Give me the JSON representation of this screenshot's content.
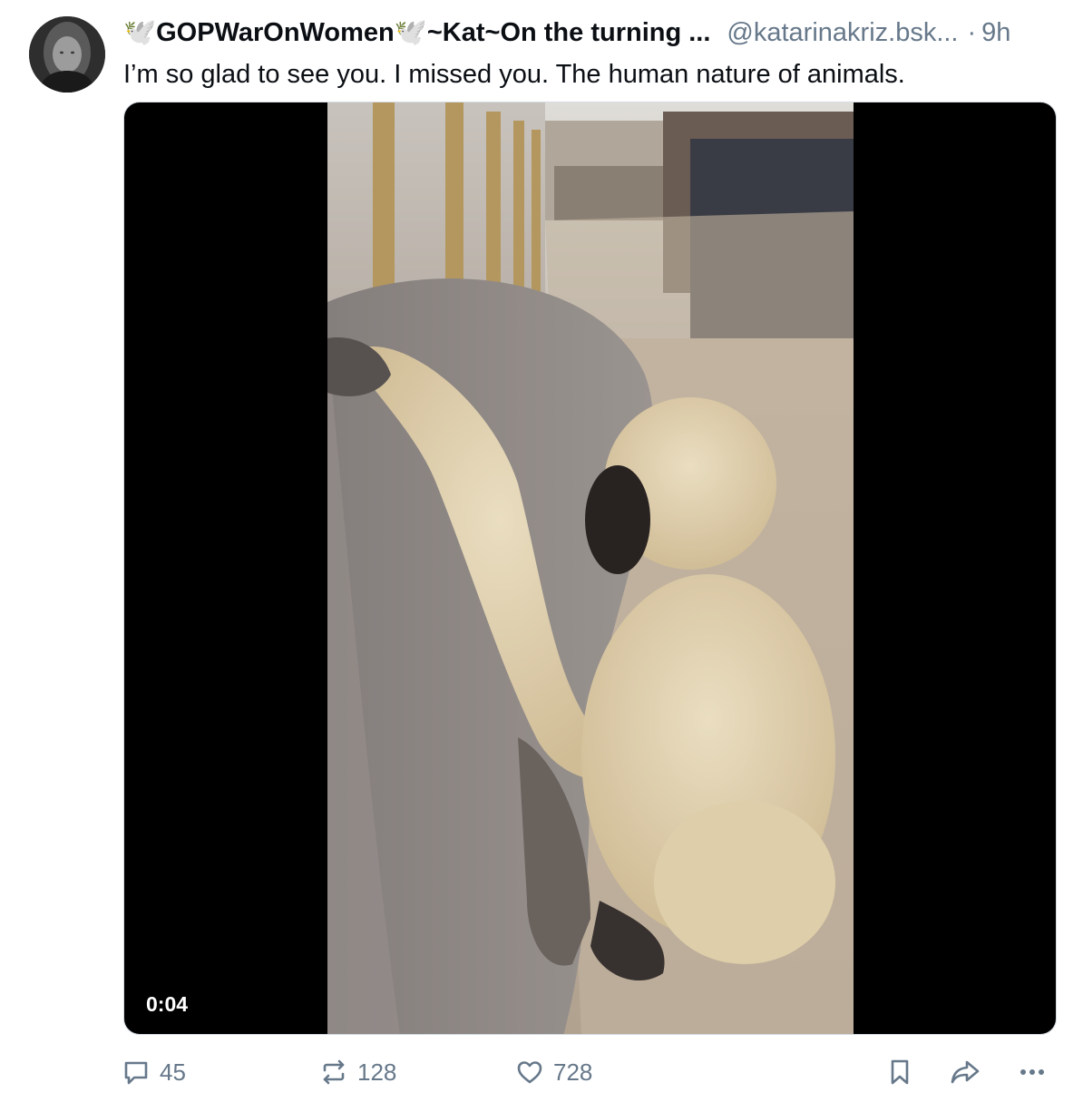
{
  "post": {
    "author": {
      "display_name": "🕊️GOPWarOnWomen🕊️~Kat~On the turning ...",
      "handle": "@katarinakriz.bsk...",
      "separator": "·",
      "time": "9h",
      "avatar_icon": "profile-photo"
    },
    "text": "I’m so glad to see you. I missed you. The human nature of animals.",
    "media": {
      "type": "video",
      "duration": "0:04"
    },
    "actions": {
      "reply_count": "45",
      "repost_count": "128",
      "like_count": "728",
      "reply_icon": "speech-bubble-icon",
      "repost_icon": "repost-arrows-icon",
      "like_icon": "heart-icon",
      "bookmark_icon": "bookmark-icon",
      "share_icon": "share-arrow-icon",
      "more_icon": "ellipsis-icon"
    }
  },
  "colors": {
    "text_primary": "#0b0f14",
    "text_secondary": "#66788a",
    "video_background": "#000000"
  }
}
